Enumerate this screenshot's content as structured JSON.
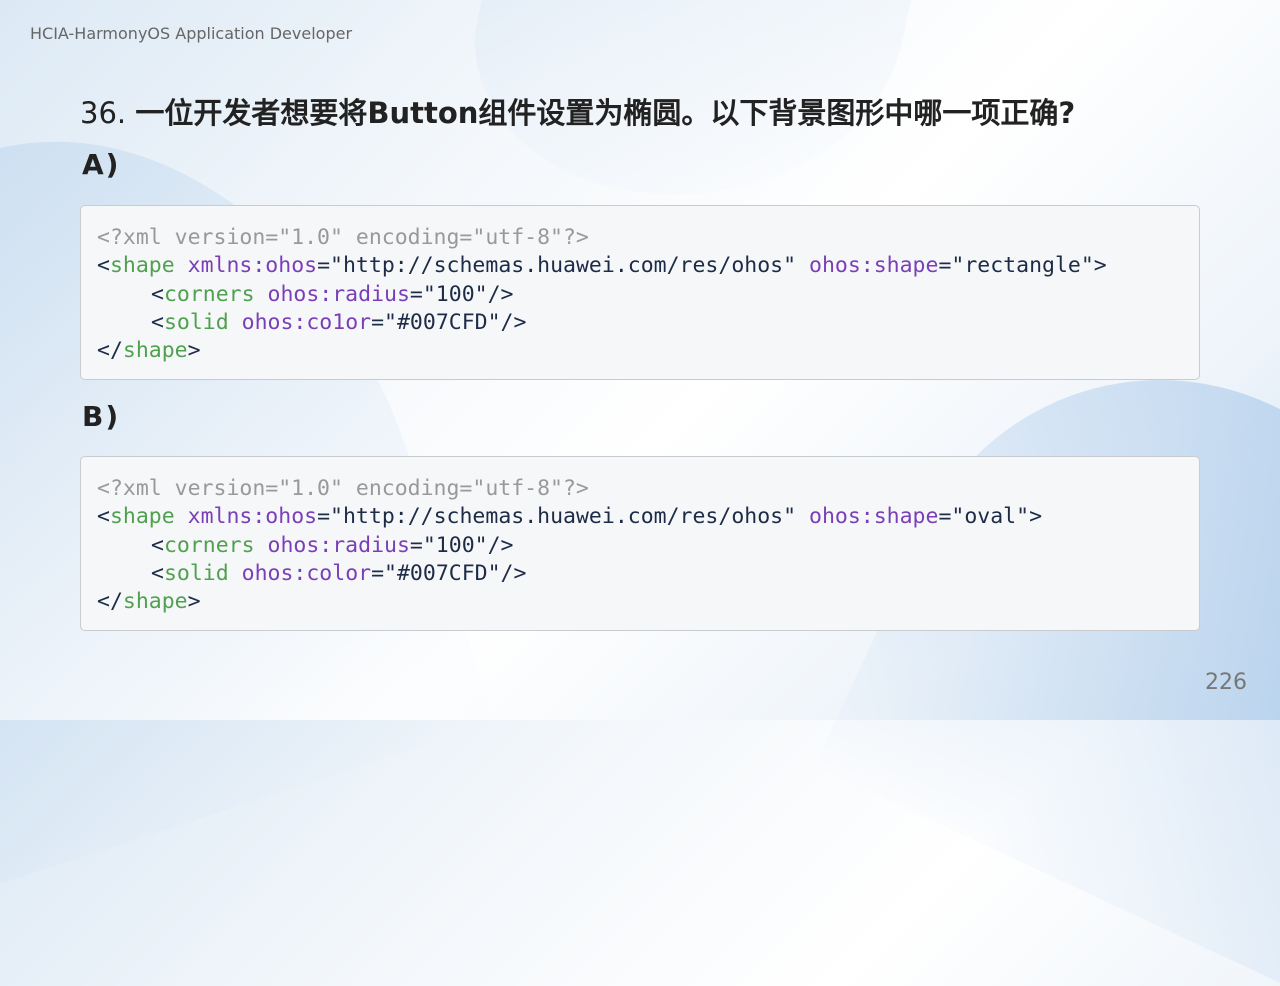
{
  "header": {
    "text": "HCIA-HarmonyOS Application Developer"
  },
  "question": {
    "number": "36.",
    "text": "一位开发者想要将Button组件设置为椭圆。以下背景图形中哪一项正确?"
  },
  "options": [
    {
      "label": "A)",
      "xml_decl": "<?xml version=\"1.0\" encoding=\"utf-8\"?>",
      "shape_open_lt": "<",
      "shape_tag": "shape",
      "xmlns_attr": "xmlns:ohos",
      "xmlns_val": "\"http://schemas.huawei.com/res/ohos\"",
      "shape_attr": "ohos:shape",
      "shape_val": "\"rectangle\"",
      "corners_tag": "corners",
      "corners_attr": "ohos:radius",
      "corners_val": "\"100\"",
      "solid_tag": "solid",
      "solid_attr": "ohos:co1or",
      "solid_val": "\"#007CFD\"",
      "close_tag": "shape"
    },
    {
      "label": "B)",
      "xml_decl": "<?xml version=\"1.0\" encoding=\"utf-8\"?>",
      "shape_open_lt": "<",
      "shape_tag": "shape",
      "xmlns_attr": "xmlns:ohos",
      "xmlns_val": "\"http://schemas.huawei.com/res/ohos\"",
      "shape_attr": "ohos:shape",
      "shape_val": "\"oval\"",
      "corners_tag": "corners",
      "corners_attr": "ohos:radius",
      "corners_val": "\"100\"",
      "solid_tag": "solid",
      "solid_attr": "ohos:color",
      "solid_val": "\"#007CFD\"",
      "close_tag": "shape"
    }
  ],
  "page_number": "226"
}
